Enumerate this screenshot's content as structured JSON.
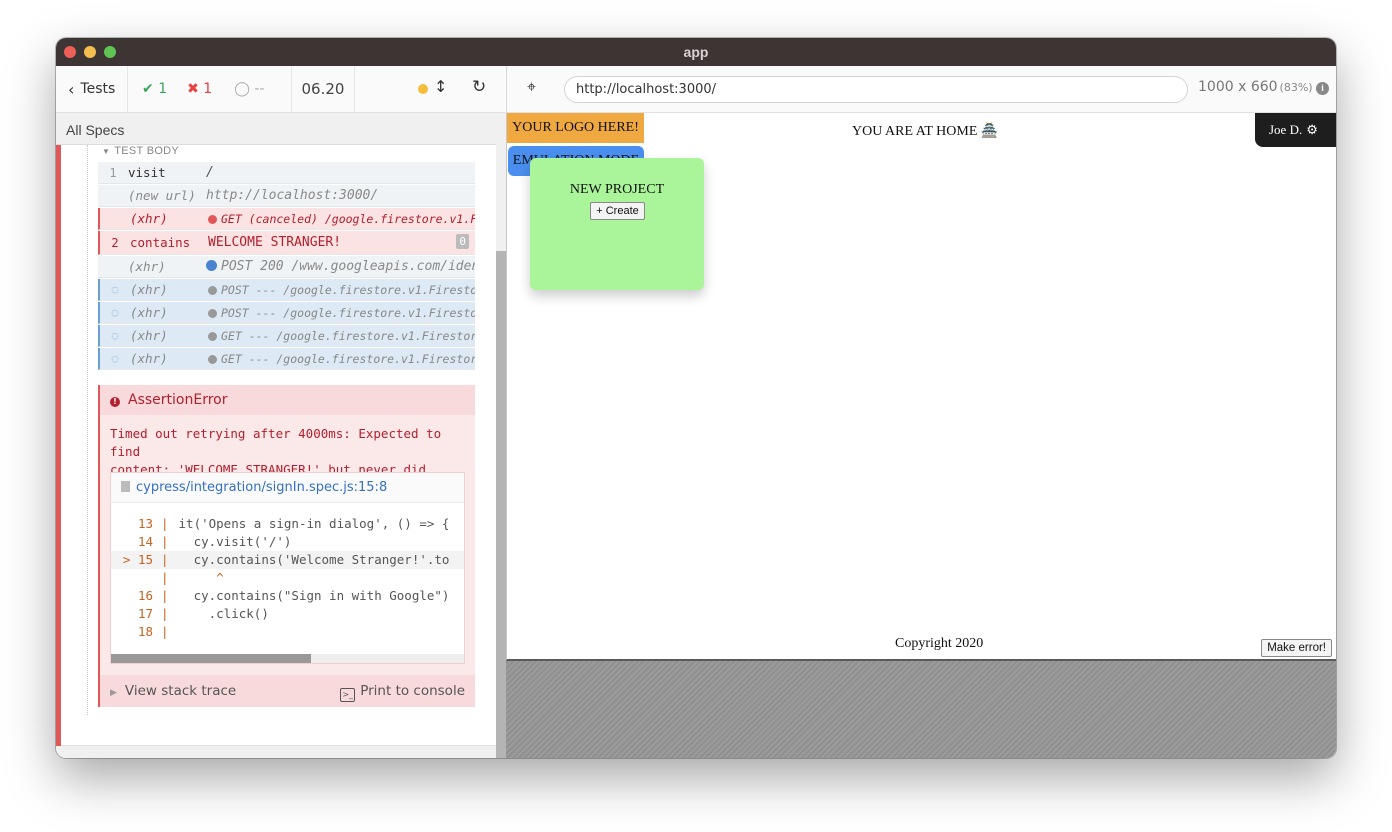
{
  "window": {
    "title": "app"
  },
  "reporter": {
    "tests_label": "Tests",
    "passed": "1",
    "failed": "1",
    "pending": "--",
    "duration": "06.20",
    "all_specs": "All Specs",
    "test_body_label": "TEST BODY",
    "commands": [
      {
        "num": "1",
        "name": "visit",
        "message": "/"
      },
      {
        "num": "",
        "name": "(new url)",
        "message": "http://localhost:3000/"
      },
      {
        "num": "",
        "name": "(xhr)",
        "message": "GET (canceled) /google.firestore.v1.Fir…",
        "dot": "#e05757"
      },
      {
        "num": "2",
        "name": "contains",
        "message": "WELCOME STRANGER!",
        "count": "0"
      },
      {
        "num": "",
        "name": "(xhr)",
        "message": "POST 200 /www.googleapis.com/iden…",
        "dot": "#4a84d0"
      },
      {
        "num": "",
        "name": "(xhr)",
        "message": "POST --- /google.firestore.v1.Firestore…",
        "dot": "#999999"
      },
      {
        "num": "",
        "name": "(xhr)",
        "message": "POST --- /google.firestore.v1.Firestore…",
        "dot": "#999999"
      },
      {
        "num": "",
        "name": "(xhr)",
        "message": "GET --- /google.firestore.v1.Firestore/…",
        "dot": "#999999"
      },
      {
        "num": "",
        "name": "(xhr)",
        "message": "GET --- /google.firestore.v1.Firestore/…",
        "dot": "#999999"
      }
    ],
    "error": {
      "title": "AssertionError",
      "message_line1": "Timed out retrying after 4000ms: Expected to find",
      "message_line2": "content: 'WELCOME STRANGER!' but never did.",
      "file_link": "cypress/integration/signIn.spec.js:15:8",
      "code": [
        {
          "ln": "13",
          "prefix": "",
          "text": "it('Opens a sign-in dialog', () => {"
        },
        {
          "ln": "14",
          "prefix": "",
          "text": "  cy.visit('/')"
        },
        {
          "ln": "15",
          "prefix": "> ",
          "text": "  cy.contains('Welcome Stranger!'.to"
        },
        {
          "ln": "",
          "prefix": "",
          "text": "     ^"
        },
        {
          "ln": "16",
          "prefix": "",
          "text": "  cy.contains(\"Sign in with Google\")"
        },
        {
          "ln": "17",
          "prefix": "",
          "text": "    .click()"
        },
        {
          "ln": "18",
          "prefix": "",
          "text": ""
        }
      ],
      "view_stack": "View stack trace",
      "print_console": "Print to console"
    }
  },
  "aut": {
    "url": "http://localhost:3000/",
    "viewport": "1000 x 660",
    "scale": "(83%)",
    "app": {
      "logo": "YOUR LOGO HERE!",
      "emulation": "EMULATION MODE",
      "home": "YOU ARE AT HOME 🏯",
      "user": "Joe D.",
      "project_title": "NEW PROJECT",
      "create_btn": "+ Create",
      "copyright": "Copyright 2020",
      "make_error": "Make error!"
    }
  },
  "colors": {
    "pass": "#3ba55d",
    "fail": "#e94040",
    "logo_bg": "#f0a840",
    "emulation_bg": "#4a8fef",
    "card_bg": "#aaf49a"
  }
}
